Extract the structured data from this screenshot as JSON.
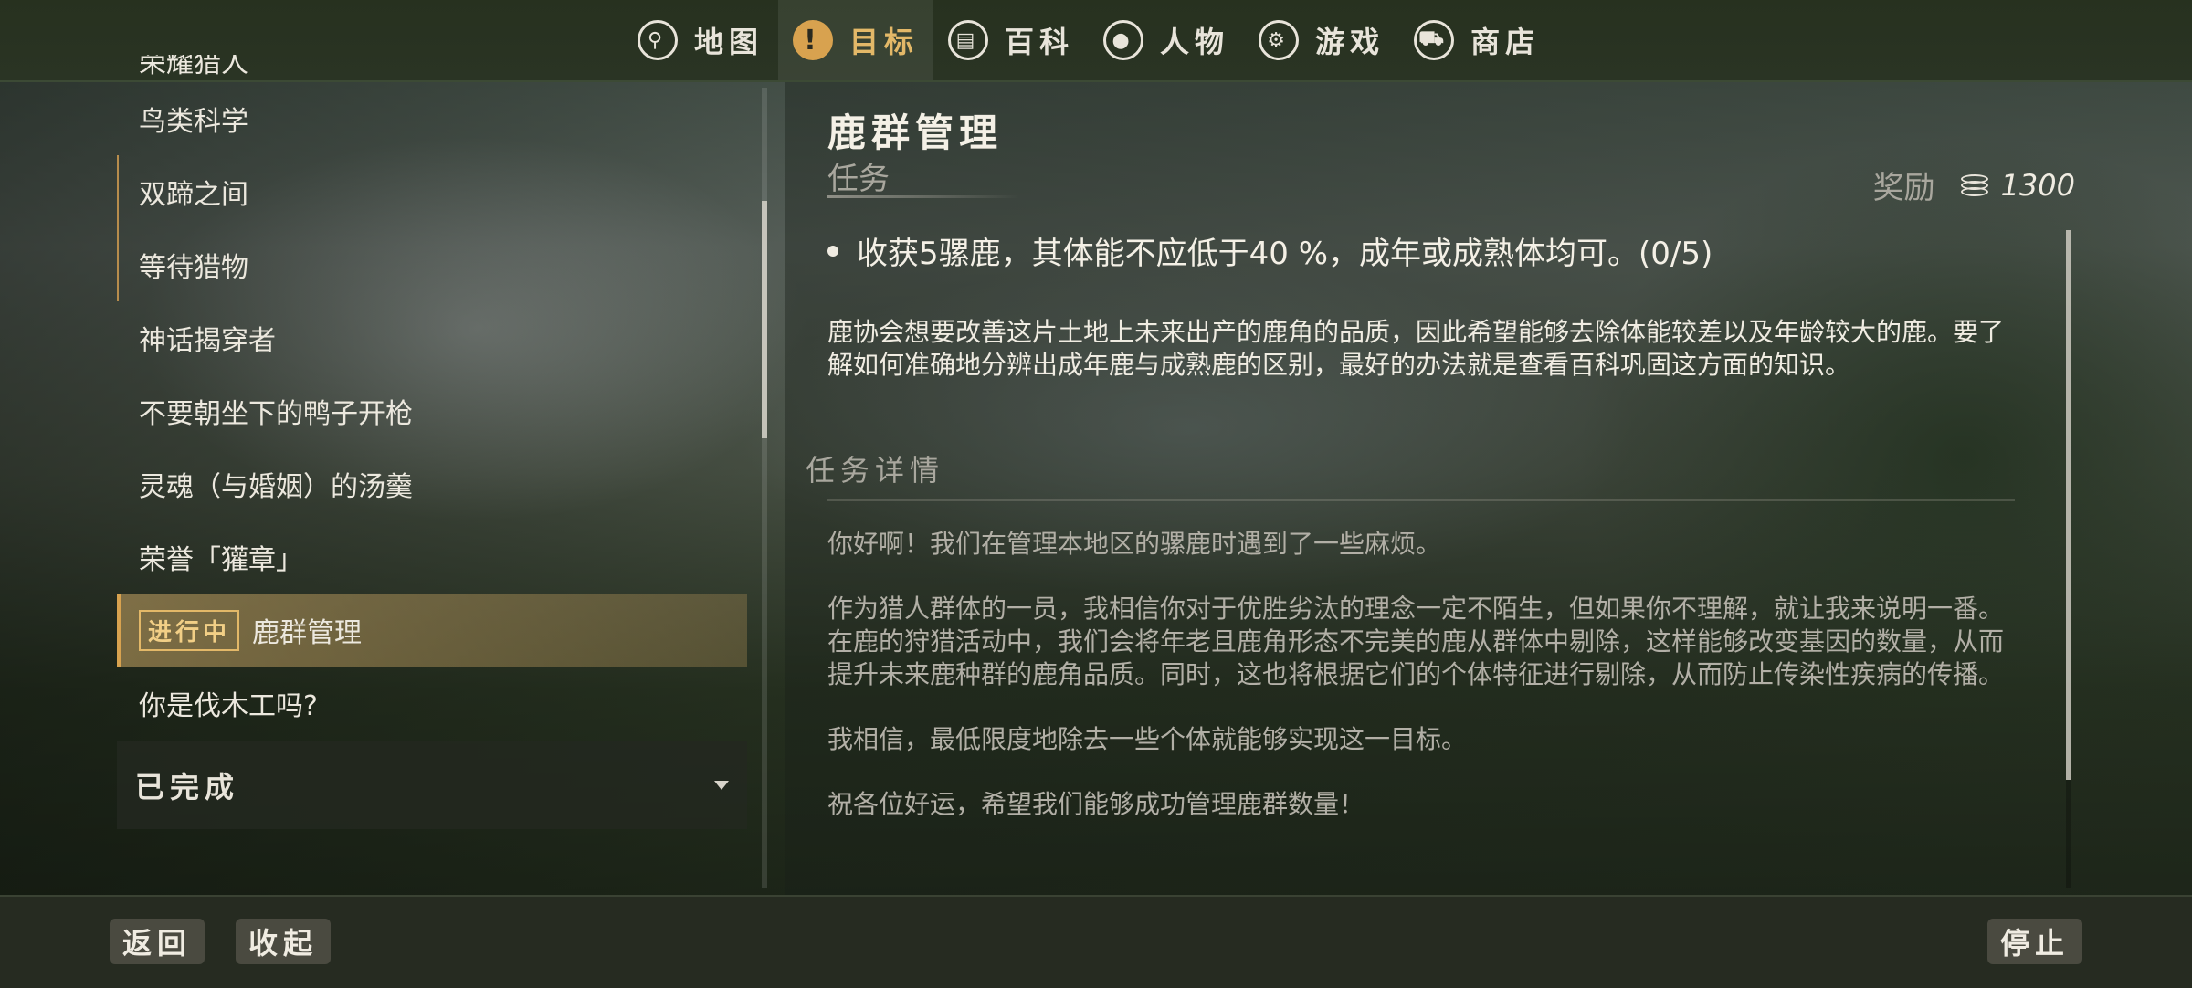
{
  "nav": {
    "items": [
      {
        "label": "地图",
        "icon": "map-pin-icon",
        "glyph": "⚲"
      },
      {
        "label": "目标",
        "icon": "exclamation-icon",
        "glyph": "!"
      },
      {
        "label": "百科",
        "icon": "book-icon",
        "glyph": "▤"
      },
      {
        "label": "人物",
        "icon": "person-icon",
        "glyph": "●"
      },
      {
        "label": "游戏",
        "icon": "gear-icon",
        "glyph": "⚙"
      },
      {
        "label": "商店",
        "icon": "cart-icon",
        "glyph": "⛟"
      }
    ],
    "active": "目标"
  },
  "missions": {
    "items": [
      {
        "label": "荣耀猎人"
      },
      {
        "label": "鸟类科学"
      },
      {
        "label": "双蹄之间"
      },
      {
        "label": "等待猎物"
      },
      {
        "label": "神话揭穿者"
      },
      {
        "label": "不要朝坐下的鸭子开枪"
      },
      {
        "label": "灵魂（与婚姻）的汤羹"
      },
      {
        "label": "荣誉「獾章」"
      },
      {
        "label": "鹿群管理",
        "badge": "进行中"
      },
      {
        "label": "你是伐木工吗?"
      }
    ],
    "completed_label": "已完成"
  },
  "detail": {
    "title": "鹿群管理",
    "subtitle": "任务",
    "reward_label": "奖励",
    "reward_value": "1300",
    "objective": "收获5骡鹿，其体能不应低于40 %，成年或成熟体均可。(0/5)",
    "description": "鹿协会想要改善这片土地上未来出产的鹿角的品质，因此希望能够去除体能较差以及年龄较大的鹿。要了解如何准确地分辨出成年鹿与成熟鹿的区别，最好的办法就是查看百科巩固这方面的知识。",
    "section_title": "任务详情",
    "paragraphs": [
      "你好啊！我们在管理本地区的骡鹿时遇到了一些麻烦。",
      "作为猎人群体的一员，我相信你对于优胜劣汰的理念一定不陌生，但如果你不理解，就让我来说明一番。在鹿的狩猎活动中，我们会将年老且鹿角形态不完美的鹿从群体中剔除，这样能够改变基因的数量，从而提升未来鹿种群的鹿角品质。同时，这也将根据它们的个体特征进行剔除，从而防止传染性疾病的传播。",
      "我相信，最低限度地除去一些个体就能够实现这一目标。",
      "祝各位好运，希望我们能够成功管理鹿群数量！"
    ]
  },
  "bottom": {
    "back": "返回",
    "collapse": "收起",
    "stop": "停止"
  }
}
